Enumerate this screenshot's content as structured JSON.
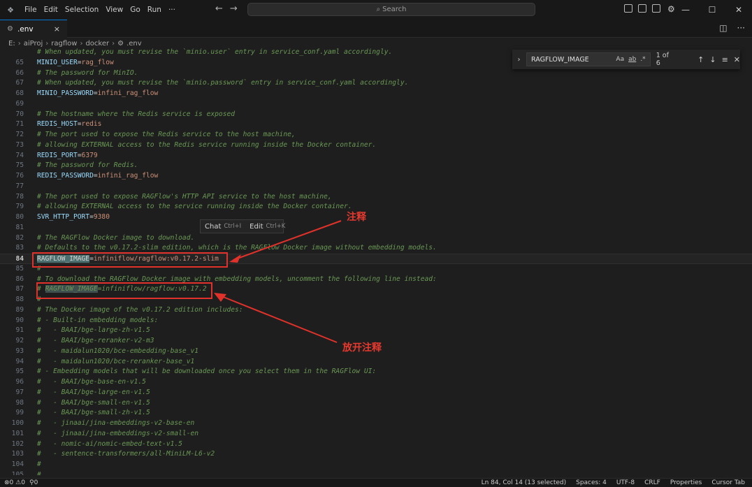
{
  "menu": [
    "File",
    "Edit",
    "Selection",
    "View",
    "Go",
    "Run",
    "···"
  ],
  "search_label": "Search",
  "tab": {
    "name": ".env",
    "close": "×"
  },
  "breadcrumb": [
    "E:",
    "aiProj",
    "ragflow",
    "docker",
    ".env"
  ],
  "find": {
    "query": "RAGFLOW_IMAGE",
    "count": "1 of 6",
    "opt_case": "Aa",
    "opt_word": "ab",
    "opt_regex": ".*"
  },
  "chat_tip": {
    "chat": "Chat",
    "chat_kb": "Ctrl+I",
    "edit": "Edit",
    "edit_kb": "Ctrl+K"
  },
  "annotations": {
    "comment": "注释",
    "uncomment": "放开注释"
  },
  "colors": {
    "accent": "#0078d4",
    "annotation": "#e0322a",
    "key": "#9cdcfe",
    "value": "#ce9178",
    "comment": "#6a9955"
  },
  "lines": [
    {
      "n": "",
      "t": "# When updated, you must revise the `minio.user` entry in service_conf.yaml accordingly."
    },
    {
      "n": "65",
      "k": "MINIO_USER",
      "v": "rag_flow"
    },
    {
      "n": "66",
      "t": "# The password for MinIO."
    },
    {
      "n": "67",
      "t": "# When updated, you must revise the `minio.password` entry in service_conf.yaml accordingly."
    },
    {
      "n": "68",
      "k": "MINIO_PASSWORD",
      "v": "infini_rag_flow"
    },
    {
      "n": "69",
      "t": ""
    },
    {
      "n": "70",
      "t": "# The hostname where the Redis service is exposed"
    },
    {
      "n": "71",
      "k": "REDIS_HOST",
      "v": "redis"
    },
    {
      "n": "72",
      "t": "# The port used to expose the Redis service to the host machine,"
    },
    {
      "n": "73",
      "t": "# allowing EXTERNAL access to the Redis service running inside the Docker container."
    },
    {
      "n": "74",
      "k": "REDIS_PORT",
      "v": "6379"
    },
    {
      "n": "75",
      "t": "# The password for Redis."
    },
    {
      "n": "76",
      "k": "REDIS_PASSWORD",
      "v": "infini_rag_flow"
    },
    {
      "n": "77",
      "t": ""
    },
    {
      "n": "78",
      "t": "# The port used to expose RAGFlow's HTTP API service to the host machine,"
    },
    {
      "n": "79",
      "t": "# allowing EXTERNAL access to the service running inside the Docker container."
    },
    {
      "n": "80",
      "k": "SVR_HTTP_PORT",
      "v": "9380"
    },
    {
      "n": "81",
      "t": ""
    },
    {
      "n": "82",
      "t": "# The RAGFlow Docker image to download."
    },
    {
      "n": "83",
      "t": "# Defaults to the v0.17.2-slim edition, which is the RAGFlow Docker image without embedding models."
    },
    {
      "n": "84",
      "k": "RAGFLOW_IMAGE",
      "v": "infiniflow/ragflow:v0.17.2-slim",
      "current": true,
      "hlkey": true
    },
    {
      "n": "85",
      "t": "#"
    },
    {
      "n": "86",
      "t": "# To download the RAGFlow Docker image with embedding models, uncomment the following line instead:"
    },
    {
      "n": "87",
      "c1": "# ",
      "ch": "RAGFLOW_IMAGE",
      "c2": "=infiniflow/ragflow:v0.17.2"
    },
    {
      "n": "88",
      "t": "#"
    },
    {
      "n": "89",
      "t": "# The Docker image of the v0.17.2 edition includes:"
    },
    {
      "n": "90",
      "t": "# - Built-in embedding models:"
    },
    {
      "n": "91",
      "t": "#   - BAAI/bge-large-zh-v1.5"
    },
    {
      "n": "92",
      "t": "#   - BAAI/bge-reranker-v2-m3"
    },
    {
      "n": "93",
      "t": "#   - maidalun1020/bce-embedding-base_v1"
    },
    {
      "n": "94",
      "t": "#   - maidalun1020/bce-reranker-base_v1"
    },
    {
      "n": "95",
      "t": "# - Embedding models that will be downloaded once you select them in the RAGFlow UI:"
    },
    {
      "n": "96",
      "t": "#   - BAAI/bge-base-en-v1.5"
    },
    {
      "n": "97",
      "t": "#   - BAAI/bge-large-en-v1.5"
    },
    {
      "n": "98",
      "t": "#   - BAAI/bge-small-en-v1.5"
    },
    {
      "n": "99",
      "t": "#   - BAAI/bge-small-zh-v1.5"
    },
    {
      "n": "100",
      "t": "#   - jinaai/jina-embeddings-v2-base-en"
    },
    {
      "n": "101",
      "t": "#   - jinaai/jina-embeddings-v2-small-en"
    },
    {
      "n": "102",
      "t": "#   - nomic-ai/nomic-embed-text-v1.5"
    },
    {
      "n": "103",
      "t": "#   - sentence-transformers/all-MiniLM-L6-v2"
    },
    {
      "n": "104",
      "t": "#"
    },
    {
      "n": "105",
      "t": "#"
    }
  ],
  "status": {
    "errors": "0",
    "warnings": "0",
    "ports": "0",
    "position": "Ln 84, Col 14 (13 selected)",
    "spaces": "Spaces: 4",
    "encoding": "UTF-8",
    "eol": "CRLF",
    "properties": "Properties",
    "cursor_tab": "Cursor Tab"
  }
}
